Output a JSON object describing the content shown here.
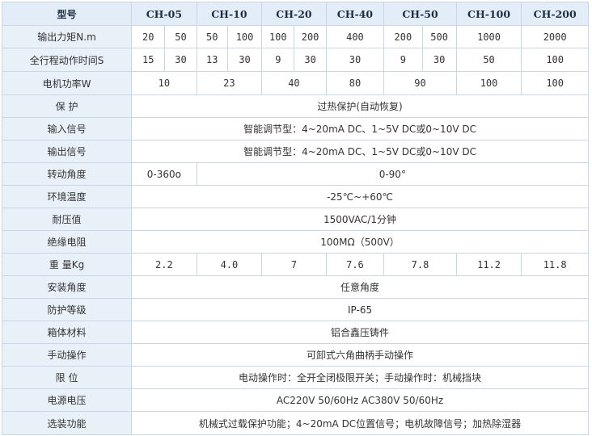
{
  "header": {
    "label": "型号",
    "models": [
      "CH-05",
      "CH-10",
      "CH-20",
      "CH-40",
      "CH-50",
      "CH-100",
      "CH-200"
    ]
  },
  "torque": {
    "label": "输出力矩N.m",
    "values": [
      "20",
      "50",
      "50",
      "100",
      "100",
      "200",
      "400",
      "200",
      "500",
      "1000",
      "2000"
    ]
  },
  "stroke_time": {
    "label": "全行程动作时间S",
    "values": [
      "15",
      "30",
      "13",
      "30",
      "9",
      "30",
      "30",
      "9",
      "30",
      "50",
      "100"
    ]
  },
  "motor_power": {
    "label": "电机功率W",
    "values": [
      "10",
      "23",
      "40",
      "80",
      "90",
      "100",
      "100"
    ]
  },
  "protection": {
    "label": "保  护",
    "value": "过热保护(自动恢复)"
  },
  "input_signal": {
    "label": "输入信号",
    "value": "智能调节型：4~20mA DC、1~5V DC或0~10V DC"
  },
  "output_signal": {
    "label": "输出信号",
    "value": "智能调节型：4~20mA DC、1~5V DC或0~10V DC"
  },
  "rotation_angle": {
    "label": "转动角度",
    "value_first": "0-360o",
    "value_rest": "0-90°"
  },
  "ambient_temp": {
    "label": "环境温度",
    "value": "-25℃~+60℃"
  },
  "withstand_voltage": {
    "label": "耐压值",
    "value": "1500VAC/1分钟"
  },
  "insulation": {
    "label": "绝缘电阻",
    "value": "100MΩ（500V）"
  },
  "weight": {
    "label": "重  量Kg",
    "values": [
      "2.2",
      "4.0",
      "7",
      "7.6",
      "7.8",
      "11.2",
      "11.8"
    ]
  },
  "install_angle": {
    "label": "安装角度",
    "value": "任意角度"
  },
  "ip_rating": {
    "label": "防护等级",
    "value": "IP-65"
  },
  "housing": {
    "label": "箱体材料",
    "value": "铝合鑫压铸件"
  },
  "manual_op": {
    "label": "手动操作",
    "value": "可卸式六角曲柄手动操作"
  },
  "limit": {
    "label": "限  位",
    "value": "电动操作时：全开全闭极限开关；手动操作时：机械挡块"
  },
  "power_supply": {
    "label": "电源电压",
    "value": "AC220V 50/60Hz AC380V 50/60Hz"
  },
  "options": {
    "label": "选装功能",
    "value": "机械式过载保护功能；4~20mA DC位置信号；电机故障信号；加热除湿器"
  }
}
